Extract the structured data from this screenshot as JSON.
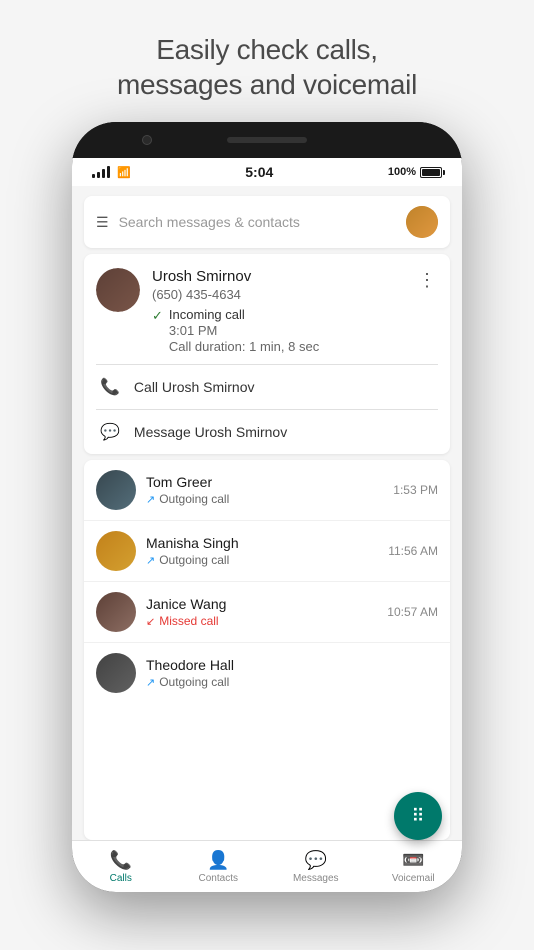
{
  "header": {
    "title": "Easily check calls,\nmessages and voicemail"
  },
  "status_bar": {
    "time": "5:04",
    "battery": "100%"
  },
  "search": {
    "placeholder": "Search messages & contacts"
  },
  "contact_card": {
    "name": "Urosh Smirnov",
    "number": "(650) 435-4634",
    "call_type": "Incoming call",
    "call_time": "3:01 PM",
    "call_duration": "Call duration: 1 min, 8 sec",
    "action_call": "Call Urosh Smirnov",
    "action_message": "Message Urosh Smirnov"
  },
  "call_list": [
    {
      "name": "Tom Greer",
      "type": "Outgoing call",
      "time": "1:53 PM",
      "missed": false
    },
    {
      "name": "Manisha Singh",
      "type": "Outgoing call",
      "time": "11:56 AM",
      "missed": false
    },
    {
      "name": "Janice Wang",
      "type": "Missed call",
      "time": "10:57 AM",
      "missed": true
    },
    {
      "name": "Theodore Hall",
      "type": "Outgoing call",
      "time": "",
      "missed": false
    }
  ],
  "bottom_nav": {
    "calls": "Calls",
    "contacts": "Contacts",
    "messages": "Messages",
    "voicemail": "Voicemail"
  }
}
